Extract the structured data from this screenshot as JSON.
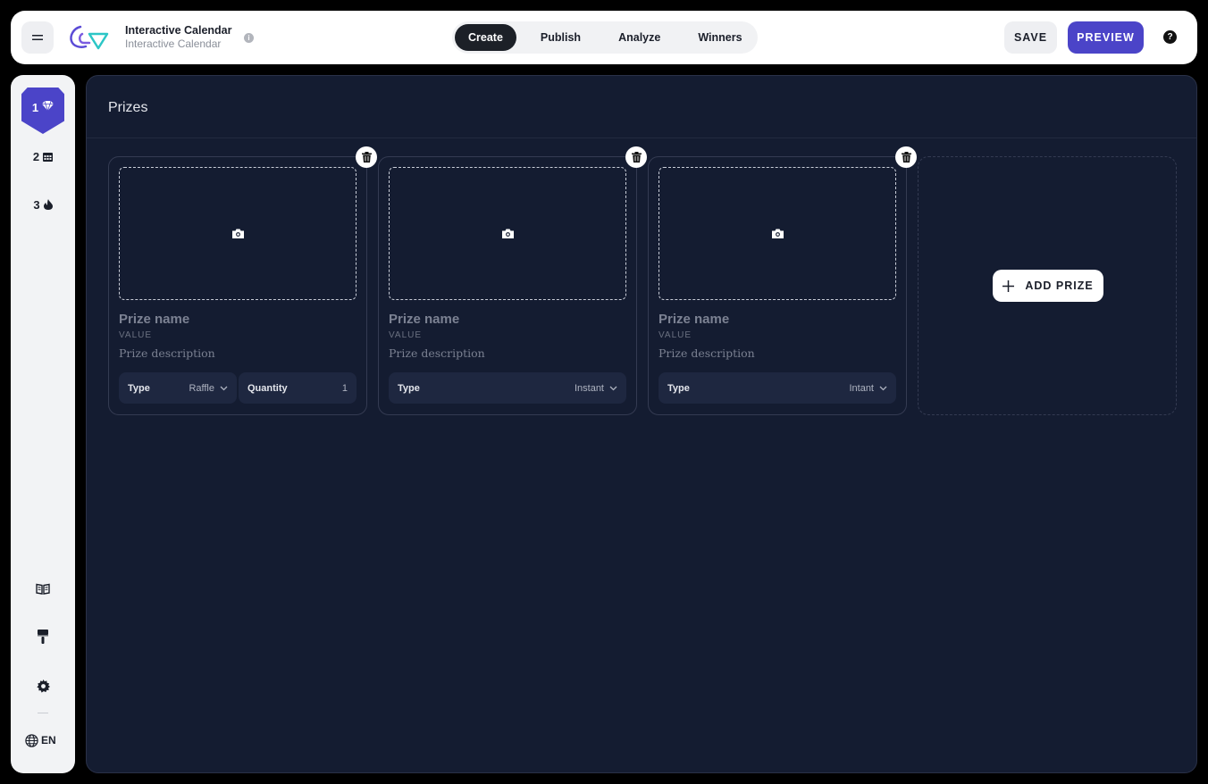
{
  "header": {
    "app_title": "Interactive Calendar",
    "app_subtitle": "Interactive Calendar",
    "info_icon": "i",
    "tabs": [
      {
        "label": "Create",
        "active": true
      },
      {
        "label": "Publish",
        "active": false
      },
      {
        "label": "Analyze",
        "active": false
      },
      {
        "label": "Winners",
        "active": false
      }
    ],
    "save_label": "SAVE",
    "preview_label": "PREVIEW",
    "help_icon": "?"
  },
  "sidebar": {
    "steps": [
      {
        "number": "1",
        "icon": "diamond-icon",
        "active": true
      },
      {
        "number": "2",
        "icon": "calendar-icon",
        "active": false
      },
      {
        "number": "3",
        "icon": "flame-icon",
        "active": false
      }
    ],
    "tools": [
      "book-icon",
      "paint-roller-icon",
      "gear-icon"
    ],
    "language": "EN"
  },
  "main": {
    "title": "Prizes",
    "prizes": [
      {
        "name": "Prize name",
        "value": "VALUE",
        "description": "Prize description",
        "type_label": "Type",
        "type_value": "Raffle",
        "quantity_label": "Quantity",
        "quantity_value": "1"
      },
      {
        "name": "Prize name",
        "value": "VALUE",
        "description": "Prize description",
        "type_label": "Type",
        "type_value": "Instant"
      },
      {
        "name": "Prize name",
        "value": "VALUE",
        "description": "Prize description",
        "type_label": "Type",
        "type_value": "Intant"
      }
    ],
    "add_prize_label": "ADD PRIZE"
  },
  "colors": {
    "accent": "#4b44c8",
    "main_bg": "#141c31",
    "topbar_bg": "#ffffff",
    "active_tab": "#1c2027"
  }
}
